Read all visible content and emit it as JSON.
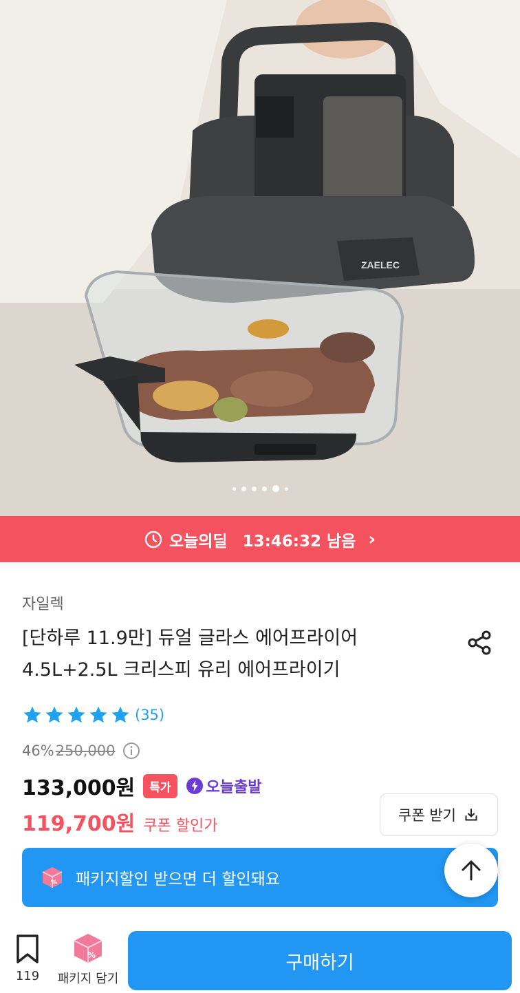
{
  "hero": {
    "logo_text": "ZAELEC",
    "carousel": {
      "count": 6,
      "active_index": 4
    }
  },
  "deal": {
    "label": "오늘의딜",
    "time_left": "13:46:32 남음",
    "chevron": "›"
  },
  "product": {
    "brand": "자일렉",
    "title_line1": "[단하루 11.9만] 듀얼 글라스 에어프라이어",
    "title_line2": "4.5L+2.5L 크리스피 유리 에어프라이기",
    "rating_stars": 5,
    "review_count": "(35)",
    "discount_percent": "46%",
    "original_price": "250,000",
    "price": "133,000원",
    "special_badge": "특가",
    "shipping_badge": "오늘출발",
    "coupon_price": "119,700원",
    "coupon_label": "쿠폰 할인가",
    "coupon_button": "쿠폰 받기"
  },
  "package_banner": {
    "text": "패키지할인 받으면 더 할인돼요"
  },
  "bottom_bar": {
    "bookmark_count": "119",
    "package_label": "패키지 담기",
    "buy_label": "구매하기"
  },
  "colors": {
    "deal_red": "#f4525e",
    "primary_blue": "#2196f3",
    "star_blue": "#1da1f2",
    "ship_purple": "#6a3bd6",
    "package_pink": "#f07a9a"
  }
}
